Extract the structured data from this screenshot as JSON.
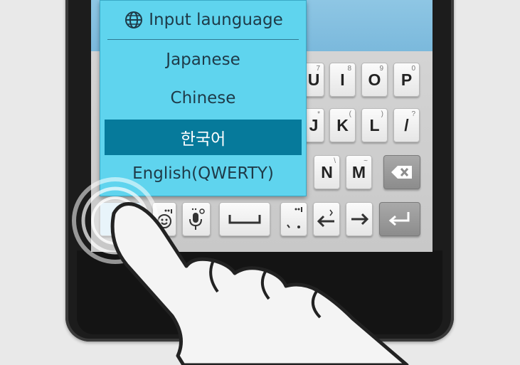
{
  "popup": {
    "title": "Input launguage",
    "items": [
      {
        "label": "Japanese",
        "selected": false
      },
      {
        "label": "Chinese",
        "selected": false
      },
      {
        "label": "한국어",
        "selected": true
      },
      {
        "label": "English(QWERTY)",
        "selected": false
      }
    ]
  },
  "keyboard": {
    "row1": [
      {
        "label": "U",
        "sup": "7"
      },
      {
        "label": "I",
        "sup": "8"
      },
      {
        "label": "O",
        "sup": "9"
      },
      {
        "label": "P",
        "sup": "0"
      }
    ],
    "row2": [
      {
        "label": "J",
        "sup": "*"
      },
      {
        "label": "K",
        "sup": "("
      },
      {
        "label": "L",
        "sup": ")"
      },
      {
        "label": "/",
        "sup": "?"
      }
    ],
    "row3": [
      {
        "label": "N",
        "sup": "\\"
      },
      {
        "label": "M",
        "sup": "~"
      }
    ]
  },
  "icons": {
    "globe": "globe-icon",
    "backspace": "backspace-icon",
    "emoticon": "emoticon-icon",
    "voice": "microphone-icon",
    "space": "space-icon",
    "punctuation": "punctuation-icon",
    "left": "arrow-left-icon",
    "right": "arrow-right-icon",
    "enter": "enter-icon"
  },
  "colors": {
    "popup_bg": "#5fd4ee",
    "selected_bg": "#067a9b",
    "keyboard_bg": "#cfcfcf",
    "phone_body": "#1c1c1c"
  }
}
